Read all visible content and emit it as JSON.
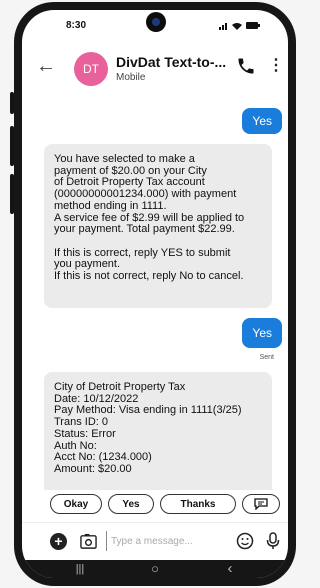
{
  "status": {
    "time": "8:30",
    "icons": "signal wifi battery"
  },
  "header": {
    "avatar_initials": "DT",
    "contact_name": "DivDat Text-to-...",
    "contact_type": "Mobile"
  },
  "messages": {
    "out1": "Yes",
    "in1": "You have selected to make a\npayment of $20.00 on your City\nof Detroit Property Tax account\n(00000000001234.000) with payment\nmethod ending in 1111.\nA service fee of $2.99 will be applied to\nyour payment. Total payment $22.99.\n\nIf this is correct, reply YES to submit\nyou payment.\nIf this is not correct, reply No to cancel.",
    "out2": "Yes",
    "sent_label": "Sent",
    "in2": "City of Detroit Property Tax\nDate: 10/12/2022\nPay Method: Visa ending in 1111(3/25)\nTrans ID: 0\nStatus: Error\nAuth No:\nAcct No: (1234.000)\nAmount: $20.00"
  },
  "quick_replies": [
    "Okay",
    "Yes",
    "Thanks"
  ],
  "composer": {
    "placeholder": "Type a message..."
  },
  "nav": {
    "recents": "|||",
    "home": "○",
    "back": "‹"
  }
}
